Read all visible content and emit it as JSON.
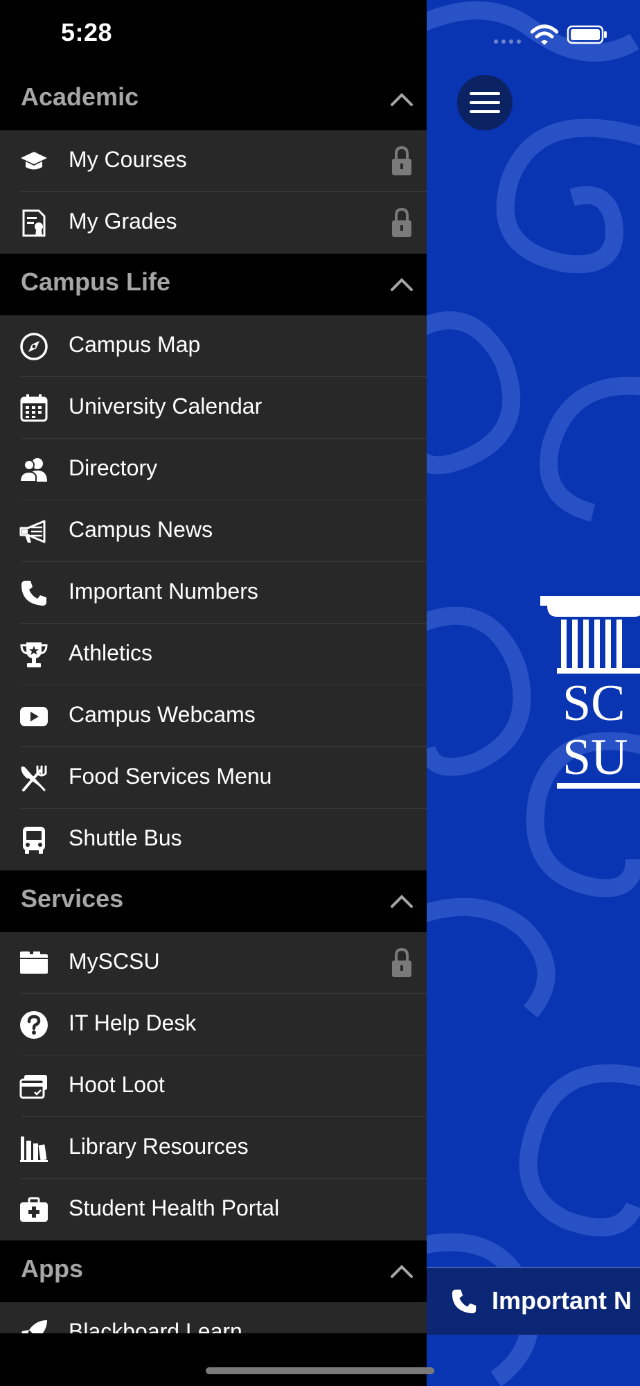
{
  "status_bar": {
    "time": "5:28"
  },
  "sections": [
    {
      "title": "Academic",
      "items": [
        {
          "label": "My Courses",
          "icon": "graduation-cap-icon",
          "locked": true
        },
        {
          "label": "My Grades",
          "icon": "certificate-document-icon",
          "locked": true
        }
      ]
    },
    {
      "title": "Campus Life",
      "items": [
        {
          "label": "Campus Map",
          "icon": "compass-icon",
          "locked": false
        },
        {
          "label": "University Calendar",
          "icon": "calendar-icon",
          "locked": false
        },
        {
          "label": "Directory",
          "icon": "people-icon",
          "locked": false
        },
        {
          "label": "Campus News",
          "icon": "megaphone-icon",
          "locked": false
        },
        {
          "label": "Important Numbers",
          "icon": "phone-icon",
          "locked": false
        },
        {
          "label": "Athletics",
          "icon": "trophy-icon",
          "locked": false
        },
        {
          "label": "Campus Webcams",
          "icon": "video-play-icon",
          "locked": false
        },
        {
          "label": "Food Services Menu",
          "icon": "fork-knife-icon",
          "locked": false
        },
        {
          "label": "Shuttle Bus",
          "icon": "bus-icon",
          "locked": false
        }
      ]
    },
    {
      "title": "Services",
      "items": [
        {
          "label": "MySCSU",
          "icon": "folder-icon",
          "locked": true
        },
        {
          "label": "IT Help Desk",
          "icon": "question-circle-icon",
          "locked": false
        },
        {
          "label": "Hoot Loot",
          "icon": "card-icon",
          "locked": false
        },
        {
          "label": "Library Resources",
          "icon": "books-icon",
          "locked": false
        },
        {
          "label": "Student Health Portal",
          "icon": "medical-kit-icon",
          "locked": false
        }
      ]
    },
    {
      "title": "Apps",
      "items": [
        {
          "label": "Blackboard Learn",
          "icon": "rocket-icon",
          "locked": false
        }
      ]
    }
  ],
  "main": {
    "logo_text_1": "SC",
    "logo_text_2": "SU",
    "quick_link_label": "Important N",
    "colors": {
      "background": "#0a35b2",
      "swirl": "#2b55c6",
      "drawer_item": "#282828",
      "section_header_text": "#a6a6a6"
    }
  }
}
